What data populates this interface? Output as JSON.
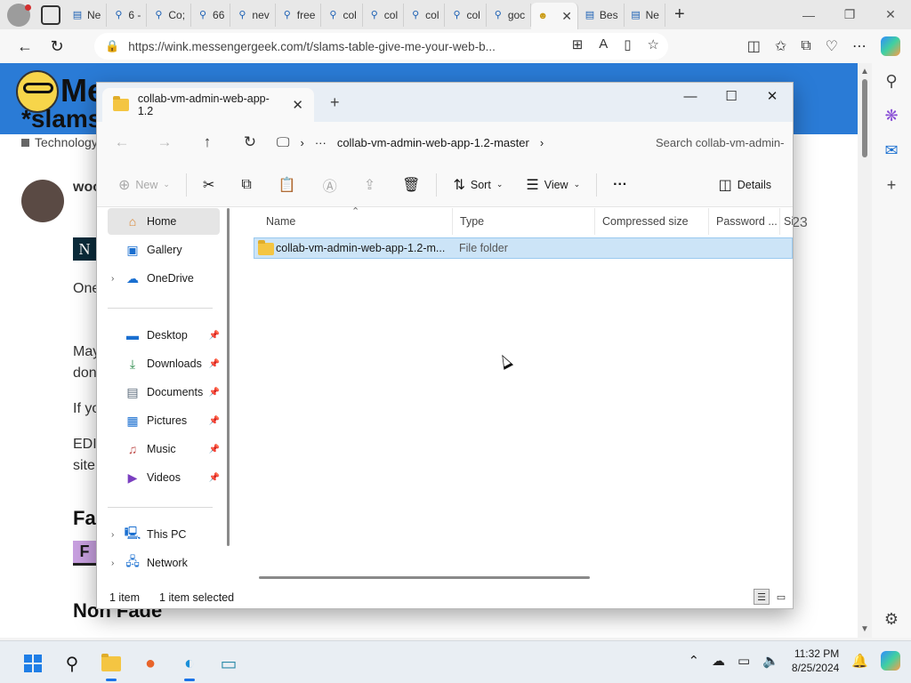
{
  "browser": {
    "tabs": [
      {
        "label": "Ne",
        "icon": "page-icon"
      },
      {
        "label": "6 -",
        "icon": "search-icon"
      },
      {
        "label": "Co;",
        "icon": "search-icon"
      },
      {
        "label": "66",
        "icon": "search-icon"
      },
      {
        "label": "nev",
        "icon": "search-icon"
      },
      {
        "label": "free",
        "icon": "search-icon"
      },
      {
        "label": "col",
        "icon": "search-icon"
      },
      {
        "label": "col",
        "icon": "search-icon"
      },
      {
        "label": "col",
        "icon": "search-icon"
      },
      {
        "label": "col",
        "icon": "search-icon"
      },
      {
        "label": "goc",
        "icon": "search-icon"
      },
      {
        "label": "",
        "icon": "nerd-smiley-icon",
        "active": true
      },
      {
        "label": "Bes",
        "icon": "page-icon"
      },
      {
        "label": "Ne",
        "icon": "page-icon"
      }
    ],
    "url": "https://wink.messengergeek.com/t/slams-table-give-me-your-web-b...",
    "page": {
      "site_name": "Me",
      "post_title": "*slams",
      "category": "Technology",
      "username": "woo",
      "lines": [
        "One",
        "May",
        "don",
        "If yo",
        "EDI",
        "site"
      ],
      "date_fragment": "23",
      "heading_fav": "Fa",
      "heading_non_fade": "Non Fade"
    }
  },
  "explorer": {
    "tab_title": "collab-vm-admin-web-app-1.2",
    "breadcrumb": {
      "ellipsis": "···",
      "current": "collab-vm-admin-web-app-1.2-master"
    },
    "search_placeholder": "Search collab-vm-admin-",
    "commands": {
      "new": "New",
      "sort": "Sort",
      "view": "View",
      "more": "···",
      "details": "Details"
    },
    "nav_pane": {
      "home": "Home",
      "gallery": "Gallery",
      "onedrive": "OneDrive",
      "desktop": "Desktop",
      "downloads": "Downloads",
      "documents": "Documents",
      "pictures": "Pictures",
      "music": "Music",
      "videos": "Videos",
      "this_pc": "This PC",
      "network": "Network"
    },
    "columns": {
      "name": "Name",
      "type": "Type",
      "compressed_size": "Compressed size",
      "password": "Password ...",
      "size": "Si"
    },
    "rows": [
      {
        "name": "collab-vm-admin-web-app-1.2-m...",
        "type": "File folder"
      }
    ],
    "status": {
      "count": "1 item",
      "selected": "1 item selected"
    }
  },
  "taskbar": {
    "time": "11:32 PM",
    "date": "8/25/2024"
  },
  "colors": {
    "site_header": "#2a7bd6",
    "selection": "#cce4f7",
    "folder": "#f4c542"
  }
}
